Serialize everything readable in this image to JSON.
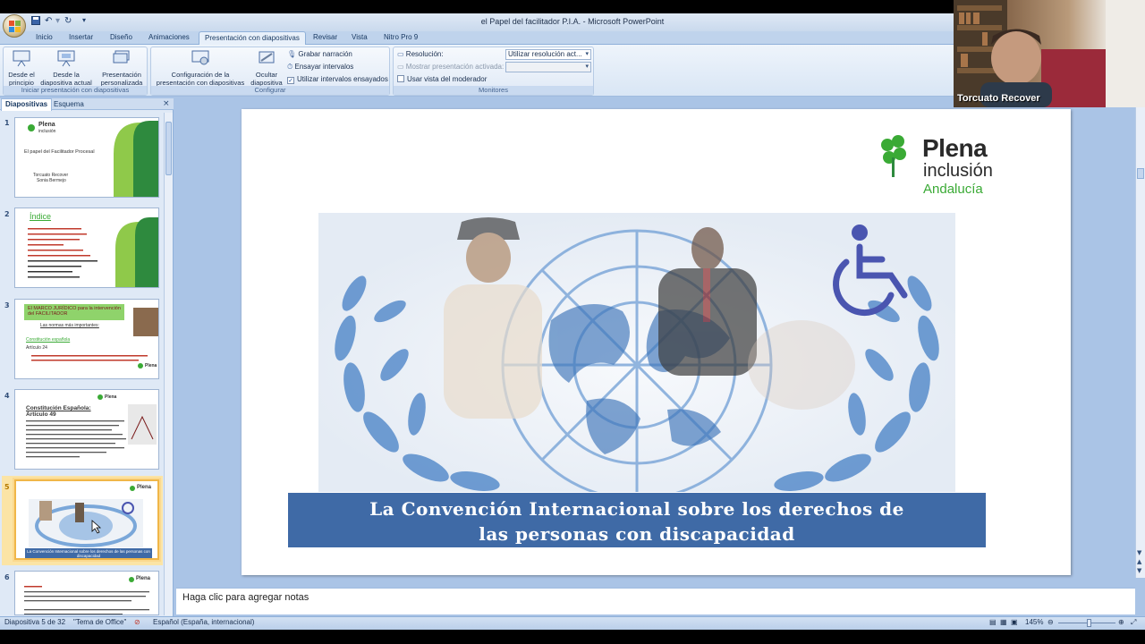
{
  "window": {
    "title": "el Papel del facilitador P.I.A. - Microsoft PowerPoint"
  },
  "tabs": [
    "Inicio",
    "Insertar",
    "Diseño",
    "Animaciones",
    "Presentación con diapositivas",
    "Revisar",
    "Vista",
    "Nitro Pro 9"
  ],
  "ribbon": {
    "group_start": {
      "label": "Iniciar presentación con diapositivas",
      "btn_from_start": "Desde el principio",
      "btn_from_current": "Desde la diapositiva actual",
      "btn_custom": "Presentación personalizada"
    },
    "group_config": {
      "label": "Configurar",
      "btn_setup": "Configuración de la presentación con diapositivas",
      "btn_hide": "Ocultar diapositiva",
      "record": "Grabar narración",
      "rehearse": "Ensayar intervalos",
      "use_timings": "Utilizar intervalos ensayados"
    },
    "group_monitors": {
      "label": "Monitores",
      "resolution_label": "Resolución:",
      "resolution_value": "Utilizar resolución act...",
      "show_on_label": "Mostrar presentación activada:",
      "presenter_view": "Usar vista del moderador"
    }
  },
  "panel": {
    "tab_slides": "Diapositivas",
    "tab_outline": "Esquema",
    "close": "×",
    "slide_numbers": [
      "1",
      "2",
      "3",
      "4",
      "5",
      "6"
    ],
    "thumb1": {
      "brand": "Plena",
      "brand2": "inclusión",
      "title": "El papel del  Facilitador  Procesal",
      "author1": "Torcuato Recover",
      "author2": "Sonia Bermejo"
    },
    "thumb2": {
      "title": "Índice"
    },
    "thumb3": {
      "title": "El MARCO JURÍDICO para la intervención del FACILITADOR",
      "subtitle": "Las normas más importantes:",
      "link": "Constitución española",
      "article": "Artículo 24",
      "brand": "Plena"
    },
    "thumb4": {
      "title": "Constitución Española:",
      "article": "Artículo 49",
      "brand": "Plena"
    },
    "thumb5": {
      "brand": "Plena",
      "banner": "La Convención Internacional sobre los derechos de las personas con discapacidad"
    },
    "thumb6": {
      "brand": "Plena"
    }
  },
  "slide": {
    "brand_name": "Plena",
    "brand_sub": "inclusión",
    "brand_region": "Andalucía",
    "banner_line1": "La Convención Internacional sobre los derechos de",
    "banner_line2": "las personas con discapacidad"
  },
  "notes": {
    "placeholder": "Haga clic para agregar notas"
  },
  "status": {
    "slide_info": "Diapositiva 5 de 32",
    "theme": "\"Tema de Office\"",
    "language": "Español (España, internacional)",
    "zoom": "145%"
  },
  "webcam": {
    "name": "Torcuato Recover"
  },
  "colors": {
    "accent_blue": "#3f6aa6",
    "brand_green": "#3aaa35",
    "selection": "#f0b648"
  }
}
